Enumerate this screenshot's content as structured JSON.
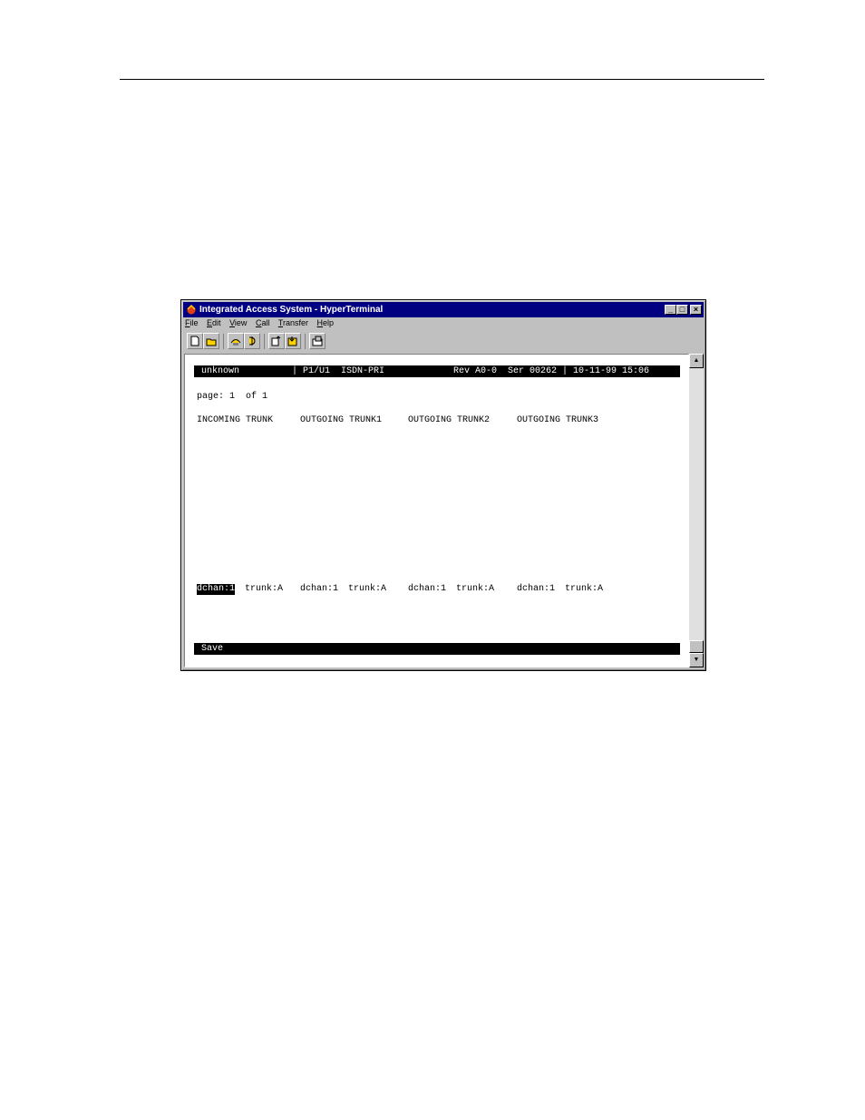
{
  "window": {
    "title": "Integrated Access System - HyperTerminal",
    "controls": {
      "minimize": "_",
      "maximize": "□",
      "close": "×"
    }
  },
  "menu": {
    "items": [
      {
        "accel": "F",
        "rest": "ile"
      },
      {
        "accel": "E",
        "rest": "dit"
      },
      {
        "accel": "V",
        "rest": "iew"
      },
      {
        "accel": "C",
        "rest": "all"
      },
      {
        "accel": "T",
        "rest": "ransfer"
      },
      {
        "accel": "H",
        "rest": "elp"
      }
    ]
  },
  "toolbar": {
    "icons": [
      "new-icon",
      "open-icon",
      "connect-icon",
      "disconnect-icon",
      "send-icon",
      "receive-icon",
      "properties-icon"
    ]
  },
  "terminal": {
    "status": {
      "name": "unknown",
      "module": "| P1/U1  ISDN-PRI",
      "rev": "Rev A0-0  Ser 00262 | 10-11-99 15:06"
    },
    "page_line": "page: 1  of 1",
    "headers": [
      "INCOMING TRUNK",
      "OUTGOING TRUNK1",
      "OUTGOING TRUNK2",
      "OUTGOING TRUNK3"
    ],
    "fields": [
      {
        "dchan": "dchan:1",
        "trunk": "trunk:A"
      },
      {
        "dchan": "dchan:1",
        "trunk": "trunk:A"
      },
      {
        "dchan": "dchan:1",
        "trunk": "trunk:A"
      },
      {
        "dchan": "dchan:1",
        "trunk": "trunk:A"
      }
    ],
    "command": "Save"
  },
  "scrollbar": {
    "up": "▲",
    "down": "▼"
  }
}
